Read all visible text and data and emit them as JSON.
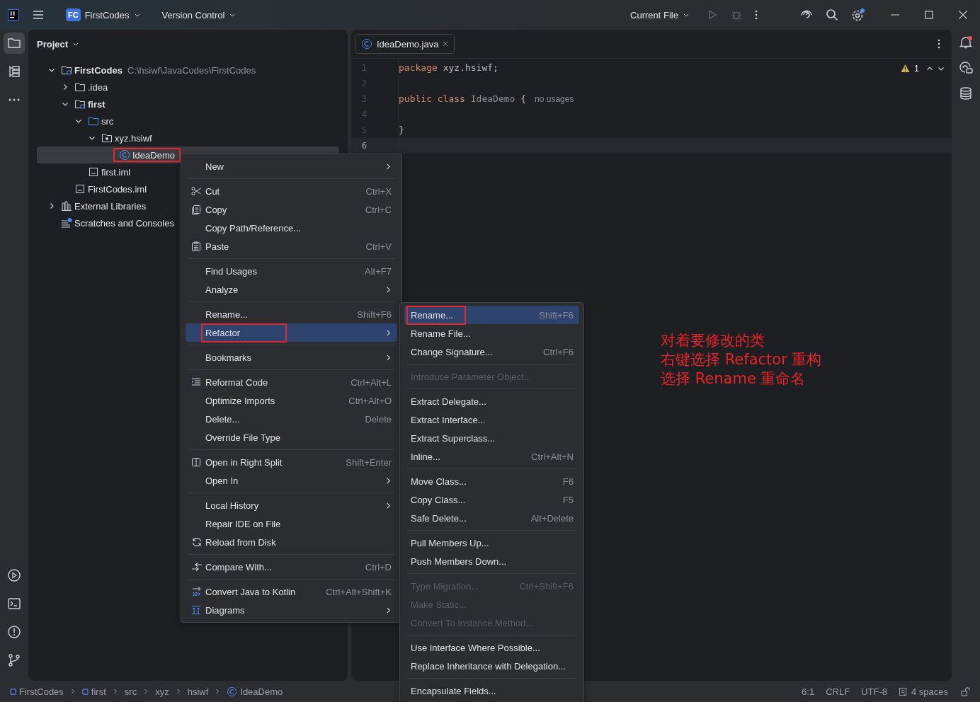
{
  "title_bar": {
    "project_badge": "FC",
    "project": "FirstCodes",
    "vcs": "Version Control",
    "run_config": "Current File",
    "settings_badge": true
  },
  "tool_stripe": {
    "items": [
      {
        "selected": true
      },
      {
        "selected": false
      },
      {
        "selected": false
      }
    ],
    "bottom_items": [
      {
        "selected": false
      },
      {
        "selected": false
      },
      {
        "selected": false
      },
      {
        "selected": false
      }
    ]
  },
  "project_panel": {
    "title": "Project",
    "tree": [
      {
        "label": "FirstCodes",
        "path": "C:\\hsiwf\\JavaCodes\\FirstCodes",
        "kind": "module",
        "bold": true,
        "selected": false,
        "outlined": false,
        "expanded": true,
        "children": [
          {
            "label": ".idea",
            "kind": "folder",
            "bold": false,
            "selected": false,
            "outlined": false,
            "expanded": false
          },
          {
            "label": "first",
            "kind": "module",
            "bold": true,
            "selected": false,
            "outlined": false,
            "expanded": true,
            "children": [
              {
                "label": "src",
                "kind": "src",
                "bold": false,
                "selected": false,
                "outlined": false,
                "expanded": true,
                "children": [
                  {
                    "label": "xyz.hsiwf",
                    "kind": "package",
                    "bold": false,
                    "selected": false,
                    "outlined": false,
                    "expanded": true,
                    "children": [
                      {
                        "label": "IdeaDemo",
                        "kind": "class",
                        "bold": false,
                        "selected": true,
                        "outlined": true
                      }
                    ]
                  }
                ]
              },
              {
                "label": "first.iml",
                "kind": "file",
                "bold": false,
                "selected": false,
                "outlined": false
              }
            ]
          },
          {
            "label": "FirstCodes.iml",
            "kind": "file",
            "bold": false,
            "selected": false,
            "outlined": false
          }
        ]
      },
      {
        "label": "External Libraries",
        "kind": "library",
        "bold": false,
        "selected": false,
        "outlined": false,
        "expanded": false
      },
      {
        "label": "Scratches and Consoles",
        "kind": "scratches",
        "bold": false,
        "selected": false,
        "outlined": false
      }
    ]
  },
  "editor": {
    "tabs": [
      {
        "label": "IdeaDemo.java",
        "selected": true
      }
    ],
    "warnings": "1",
    "lines": [
      {
        "number": "1",
        "current": false,
        "tokens": [
          {
            "text": "package",
            "kind": "keyword"
          },
          {
            "text": "xyz.hsiwf;",
            "kind": "plain"
          }
        ]
      },
      {
        "number": "2",
        "current": false
      },
      {
        "number": "3",
        "current": false,
        "tokens": [
          {
            "text": "public",
            "kind": "keyword"
          },
          {
            "text": "class",
            "kind": "keyword"
          },
          {
            "text": "IdeaDemo",
            "kind": "unused"
          },
          {
            "text": "{",
            "kind": "plain"
          },
          {
            "text": "no usages",
            "kind": "hint"
          }
        ]
      },
      {
        "number": "4",
        "current": false
      },
      {
        "number": "5",
        "current": false,
        "tokens": [
          {
            "text": "}",
            "kind": "plain"
          }
        ]
      },
      {
        "number": "6",
        "current": true
      }
    ]
  },
  "context_menu": {
    "groups": [
      {
        "items": [
          {
            "label": "New",
            "submenu": true,
            "disabled": false,
            "selected": false,
            "outlined": false
          }
        ]
      },
      {
        "items": [
          {
            "label": "Cut",
            "shortcut": "Ctrl+X",
            "kind": "scissors",
            "submenu": false,
            "disabled": false,
            "selected": false,
            "outlined": false
          },
          {
            "label": "Copy",
            "shortcut": "Ctrl+C",
            "kind": "copy",
            "submenu": false,
            "disabled": false,
            "selected": false,
            "outlined": false
          },
          {
            "label": "Copy Path/Reference...",
            "submenu": false,
            "disabled": false,
            "selected": false,
            "outlined": false
          },
          {
            "label": "Paste",
            "shortcut": "Ctrl+V",
            "kind": "paste",
            "submenu": false,
            "disabled": false,
            "selected": false,
            "outlined": false
          }
        ]
      },
      {
        "items": [
          {
            "label": "Find Usages",
            "shortcut": "Alt+F7",
            "submenu": false,
            "disabled": false,
            "selected": false,
            "outlined": false
          },
          {
            "label": "Analyze",
            "submenu": true,
            "disabled": false,
            "selected": false,
            "outlined": false
          }
        ]
      },
      {
        "items": [
          {
            "label": "Rename...",
            "shortcut": "Shift+F6",
            "submenu": false,
            "disabled": false,
            "selected": false,
            "outlined": false
          },
          {
            "label": "Refactor",
            "submenu": true,
            "disabled": false,
            "selected": true,
            "outlined": true
          }
        ]
      },
      {
        "items": [
          {
            "label": "Bookmarks",
            "submenu": true,
            "disabled": false,
            "selected": false,
            "outlined": false
          }
        ]
      },
      {
        "items": [
          {
            "label": "Reformat Code",
            "shortcut": "Ctrl+Alt+L",
            "kind": "reformat",
            "submenu": false,
            "disabled": false,
            "selected": false,
            "outlined": false
          },
          {
            "label": "Optimize Imports",
            "shortcut": "Ctrl+Alt+O",
            "submenu": false,
            "disabled": false,
            "selected": false,
            "outlined": false
          },
          {
            "label": "Delete...",
            "shortcut": "Delete",
            "submenu": false,
            "disabled": false,
            "selected": false,
            "outlined": false
          },
          {
            "label": "Override File Type",
            "submenu": false,
            "disabled": false,
            "selected": false,
            "outlined": false
          }
        ]
      },
      {
        "items": [
          {
            "label": "Open in Right Split",
            "shortcut": "Shift+Enter",
            "kind": "split",
            "submenu": false,
            "disabled": false,
            "selected": false,
            "outlined": false
          },
          {
            "label": "Open In",
            "submenu": true,
            "disabled": false,
            "selected": false,
            "outlined": false
          }
        ]
      },
      {
        "items": [
          {
            "label": "Local History",
            "submenu": true,
            "disabled": false,
            "selected": false,
            "outlined": false
          },
          {
            "label": "Repair IDE on File",
            "submenu": false,
            "disabled": false,
            "selected": false,
            "outlined": false
          },
          {
            "label": "Reload from Disk",
            "kind": "reload",
            "submenu": false,
            "disabled": false,
            "selected": false,
            "outlined": false
          }
        ]
      },
      {
        "items": [
          {
            "label": "Compare With...",
            "shortcut": "Ctrl+D",
            "kind": "compare",
            "submenu": false,
            "disabled": false,
            "selected": false,
            "outlined": false
          }
        ]
      },
      {
        "items": [
          {
            "label": "Convert Java to Kotlin",
            "shortcut": "Ctrl+Alt+Shift+K",
            "kind": "j2k",
            "submenu": false,
            "disabled": false,
            "selected": false,
            "outlined": false
          },
          {
            "label": "Diagrams",
            "kind": "diagrams",
            "submenu": true,
            "disabled": false,
            "selected": false,
            "outlined": false
          }
        ]
      }
    ]
  },
  "refactor_menu": {
    "groups": [
      {
        "items": [
          {
            "label": "Rename...",
            "shortcut": "Shift+F6",
            "disabled": false,
            "selected": true,
            "outlined": true
          },
          {
            "label": "Rename File...",
            "disabled": false,
            "selected": false,
            "outlined": false
          },
          {
            "label": "Change Signature...",
            "shortcut": "Ctrl+F6",
            "disabled": false,
            "selected": false,
            "outlined": false
          }
        ]
      },
      {
        "items": [
          {
            "label": "Introduce Parameter Object...",
            "disabled": true,
            "selected": false,
            "outlined": false
          }
        ]
      },
      {
        "items": [
          {
            "label": "Extract Delegate...",
            "disabled": false,
            "selected": false,
            "outlined": false
          },
          {
            "label": "Extract Interface...",
            "disabled": false,
            "selected": false,
            "outlined": false
          },
          {
            "label": "Extract Superclass...",
            "disabled": false,
            "selected": false,
            "outlined": false
          },
          {
            "label": "Inline...",
            "shortcut": "Ctrl+Alt+N",
            "disabled": false,
            "selected": false,
            "outlined": false
          }
        ]
      },
      {
        "items": [
          {
            "label": "Move Class...",
            "shortcut": "F6",
            "disabled": false,
            "selected": false,
            "outlined": false
          },
          {
            "label": "Copy Class...",
            "shortcut": "F5",
            "disabled": false,
            "selected": false,
            "outlined": false
          },
          {
            "label": "Safe Delete...",
            "shortcut": "Alt+Delete",
            "disabled": false,
            "selected": false,
            "outlined": false
          }
        ]
      },
      {
        "items": [
          {
            "label": "Pull Members Up...",
            "disabled": false,
            "selected": false,
            "outlined": false
          },
          {
            "label": "Push Members Down...",
            "disabled": false,
            "selected": false,
            "outlined": false
          }
        ]
      },
      {
        "items": [
          {
            "label": "Type Migration...",
            "shortcut": "Ctrl+Shift+F6",
            "disabled": true,
            "selected": false,
            "outlined": false
          },
          {
            "label": "Make Static...",
            "disabled": true,
            "selected": false,
            "outlined": false
          },
          {
            "label": "Convert To Instance Method...",
            "disabled": true,
            "selected": false,
            "outlined": false
          }
        ]
      },
      {
        "items": [
          {
            "label": "Use Interface Where Possible...",
            "disabled": false,
            "selected": false,
            "outlined": false
          },
          {
            "label": "Replace Inheritance with Delegation...",
            "disabled": false,
            "selected": false,
            "outlined": false
          }
        ]
      },
      {
        "items": [
          {
            "label": "Encapsulate Fields...",
            "disabled": false,
            "selected": false,
            "outlined": false
          }
        ]
      }
    ]
  },
  "annotation": [
    "对着要修改的类",
    "右键选择 Refactor 重构",
    "选择 Rename 重命名"
  ],
  "status_bar": {
    "breadcrumbs": [
      {
        "label": "FirstCodes",
        "kind": "module"
      },
      {
        "label": "first",
        "kind": "module"
      },
      {
        "label": "src"
      },
      {
        "label": "xyz"
      },
      {
        "label": "hsiwf"
      },
      {
        "label": "IdeaDemo",
        "kind": "class"
      }
    ],
    "position": "6:1",
    "line_separator": "CRLF",
    "encoding": "UTF-8",
    "indent": "4 spaces"
  }
}
